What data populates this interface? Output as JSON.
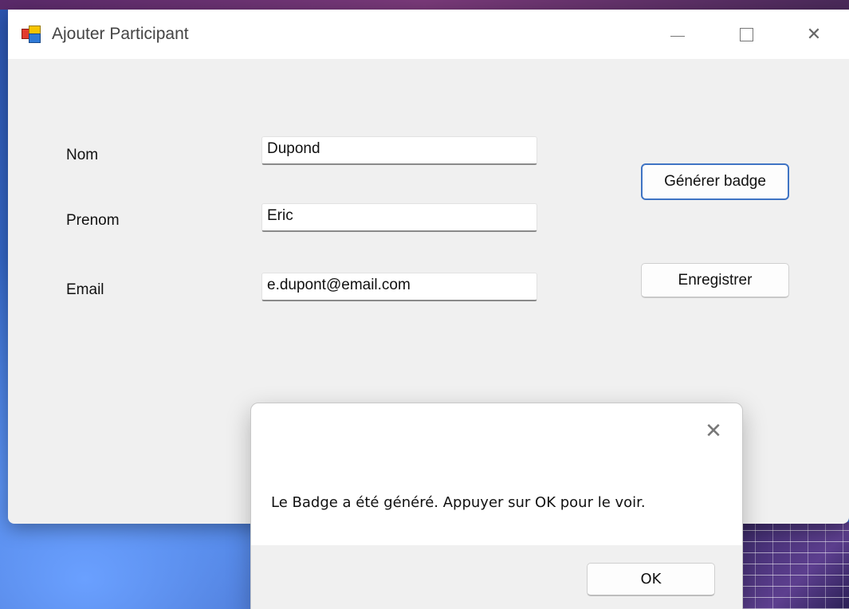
{
  "window": {
    "title": "Ajouter Participant",
    "controls": {
      "minimize_icon": "minimize-icon",
      "maximize_icon": "maximize-icon",
      "close_icon": "close-icon",
      "close_glyph": "✕"
    }
  },
  "form": {
    "nom": {
      "label": "Nom",
      "value": "Dupond"
    },
    "prenom": {
      "label": "Prenom",
      "value": "Eric"
    },
    "email": {
      "label": "Email",
      "value": "e.dupont@email.com"
    }
  },
  "buttons": {
    "generate_badge": "Générer badge",
    "save": "Enregistrer"
  },
  "message_box": {
    "text": "Le Badge a été généré. Appuyer sur OK pour le voir.",
    "ok_label": "OK",
    "close_glyph": "✕"
  },
  "colors": {
    "focus_border": "#3f74c4",
    "window_bg": "#f0f0f0"
  }
}
